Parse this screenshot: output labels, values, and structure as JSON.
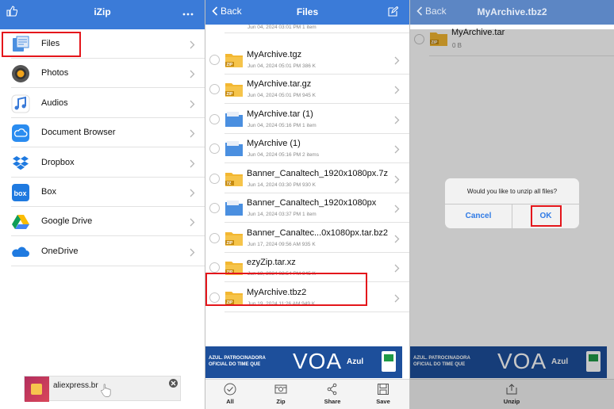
{
  "screen1": {
    "title": "iZip",
    "menu": [
      {
        "label": "Files",
        "icon": "files-icon"
      },
      {
        "label": "Photos",
        "icon": "photos-icon"
      },
      {
        "label": "Audios",
        "icon": "audios-icon"
      },
      {
        "label": "Document Browser",
        "icon": "cloud-icon"
      },
      {
        "label": "Dropbox",
        "icon": "dropbox-icon"
      },
      {
        "label": "Box",
        "icon": "box-icon"
      },
      {
        "label": "Google Drive",
        "icon": "google-drive-icon"
      },
      {
        "label": "OneDrive",
        "icon": "onedrive-icon"
      }
    ],
    "ad": {
      "text": "aliexpress.br"
    }
  },
  "screen2": {
    "back_label": "Back",
    "title": "Files",
    "files": [
      {
        "name": "",
        "meta": "Jun 04, 2024 03:01 PM   1 item",
        "type": "folder"
      },
      {
        "name": "MyArchive.tgz",
        "meta": "Jun 04, 2024 05:01 PM   386 K",
        "type": "zip",
        "badge": "ZIP"
      },
      {
        "name": "MyArchive.tar.gz",
        "meta": "Jun 04, 2024 05:01 PM   945 K",
        "type": "zip",
        "badge": "ZIP"
      },
      {
        "name": "MyArchive.tar (1)",
        "meta": "Jun 04, 2024 05:16 PM   1 item",
        "type": "folder"
      },
      {
        "name": "MyArchive (1)",
        "meta": "Jun 04, 2024 05:16 PM   2 items",
        "type": "folder"
      },
      {
        "name": "Banner_Canaltech_1920x1080px.7z",
        "meta": "Jun 14, 2024 03:30 PM   930 K",
        "type": "zip",
        "badge": "7Z"
      },
      {
        "name": "Banner_Canaltech_1920x1080px",
        "meta": "Jun 14, 2024 03:37 PM   1 item",
        "type": "folder"
      },
      {
        "name": "Banner_Canaltec...0x1080px.tar.bz2",
        "meta": "Jun 17, 2024 09:56 AM   935 K",
        "type": "zip",
        "badge": "ZIP"
      },
      {
        "name": "ezyZip.tar.xz",
        "meta": "Jun 18, 2024 02:54 PM   945 K",
        "type": "zip",
        "badge": "ZIP"
      },
      {
        "name": "MyArchive.tbz2",
        "meta": "Jun 19, 2024 11:26 AM   949 K",
        "type": "zip",
        "badge": "ZIP"
      }
    ],
    "banner": {
      "line1": "AZUL. PATROCINADORA",
      "line2": "OFICIAL DO TIME QUE",
      "big": "VOA",
      "brand": "Azul"
    },
    "toolbar": [
      {
        "label": "All",
        "icon": "check-circle-icon"
      },
      {
        "label": "Zip",
        "icon": "zip-icon"
      },
      {
        "label": "Share",
        "icon": "share-icon"
      },
      {
        "label": "Save",
        "icon": "save-icon"
      }
    ]
  },
  "screen3": {
    "back_label": "Back",
    "title": "MyArchive.tbz2",
    "item": {
      "name": "MyArchive.tar",
      "meta": "0 B",
      "badge": "ZIP"
    },
    "dialog": {
      "message": "Would you like to unzip all files?",
      "cancel": "Cancel",
      "ok": "OK"
    },
    "toolbar": {
      "label": "Unzip",
      "icon": "unzip-icon"
    }
  },
  "colors": {
    "nav": "#3b7bd8",
    "highlight": "#e4161b",
    "folder": "#4a8fe0",
    "zipfolder": "#f3b731",
    "link": "#2f7ae5"
  }
}
